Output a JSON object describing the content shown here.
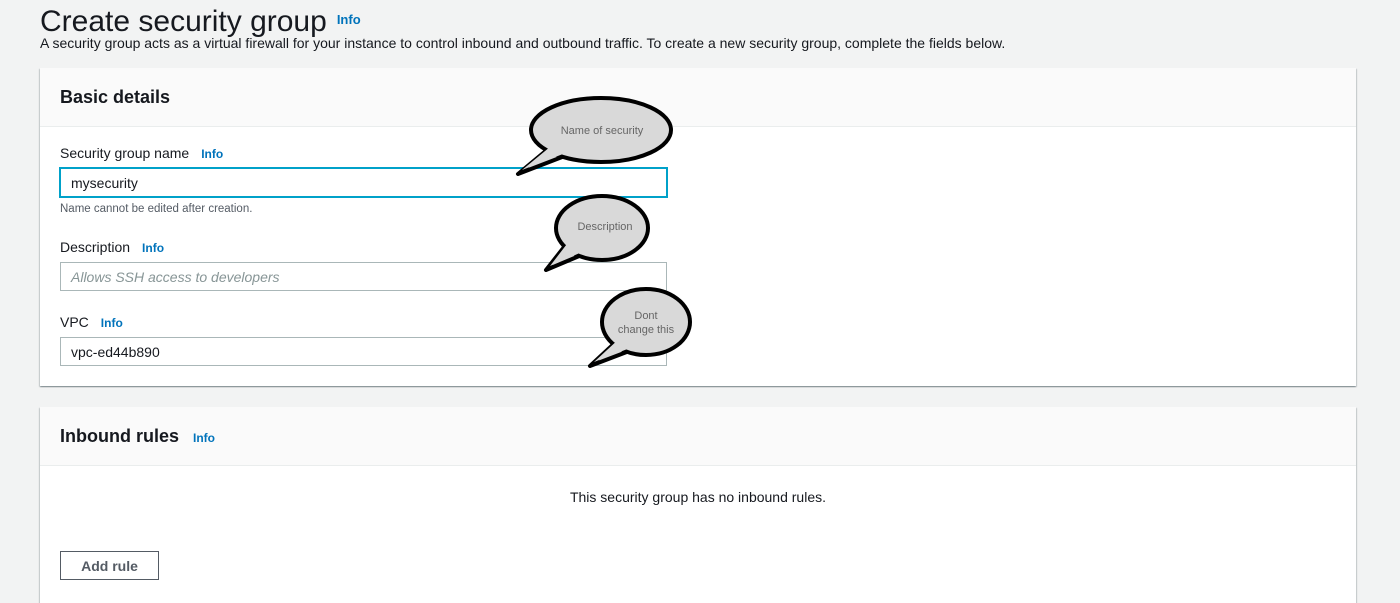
{
  "header": {
    "title": "Create security group",
    "info": "Info",
    "description": "A security group acts as a virtual firewall for your instance to control inbound and outbound traffic. To create a new security group, complete the fields below."
  },
  "basic_details": {
    "heading": "Basic details",
    "name_field": {
      "label": "Security group name",
      "info": "Info",
      "value": "mysecurity",
      "hint": "Name cannot be edited after creation."
    },
    "description_field": {
      "label": "Description",
      "info": "Info",
      "placeholder": "Allows SSH access to developers"
    },
    "vpc_field": {
      "label": "VPC",
      "info": "Info",
      "value": "vpc-ed44b890"
    }
  },
  "inbound_rules": {
    "heading": "Inbound rules",
    "info": "Info",
    "empty_message": "This security group has no inbound rules.",
    "add_button": "Add rule"
  },
  "annotations": {
    "name_callout": "Name of security",
    "description_callout": "Description",
    "vpc_callout_line1": "Dont",
    "vpc_callout_line2": "change this"
  }
}
